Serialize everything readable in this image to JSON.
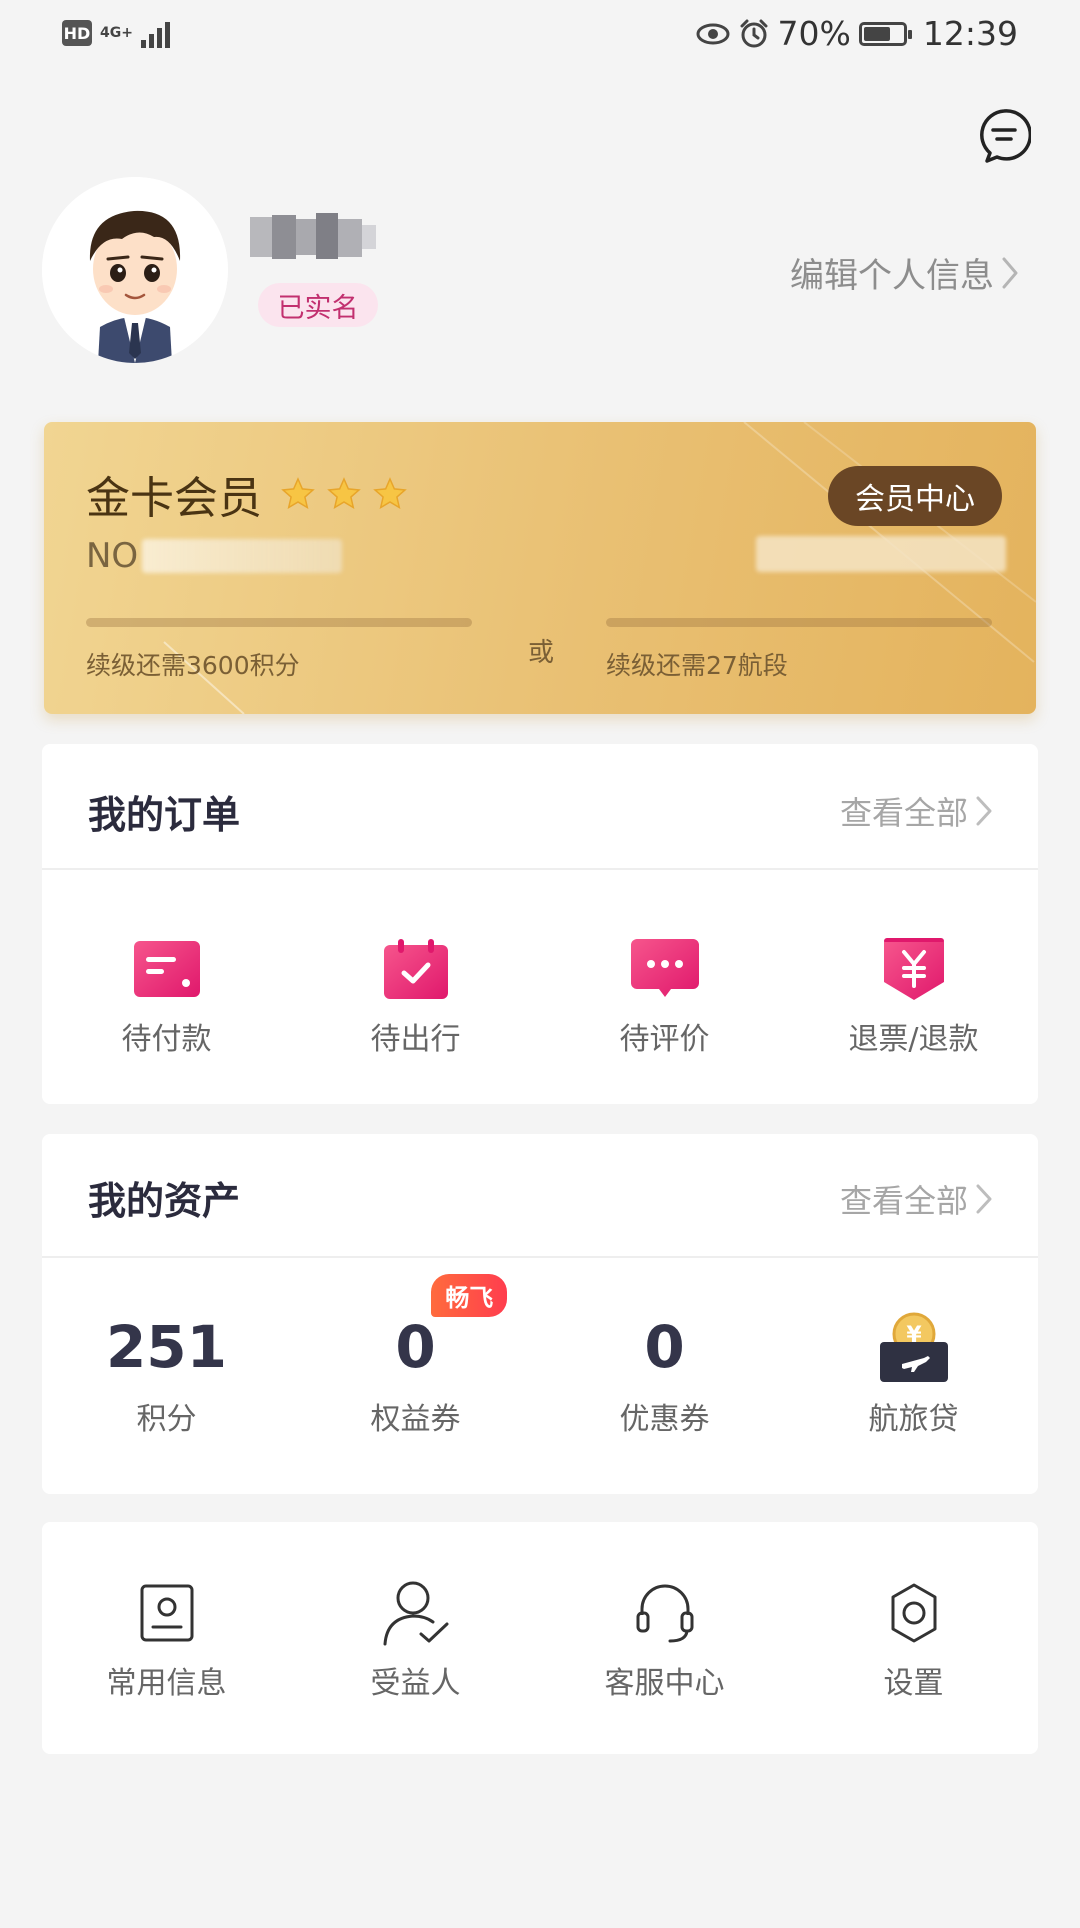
{
  "status_bar": {
    "hd_label": "HD",
    "network": "4G+",
    "battery_percent": "70%",
    "battery_level": 0.7,
    "time": "12:39",
    "icons": [
      "eye-icon",
      "alarm-icon"
    ]
  },
  "profile": {
    "verified_label": "已实名",
    "edit_label": "编辑个人信息"
  },
  "member_card": {
    "tier": "金卡会员",
    "star_count": 3,
    "card_no_prefix": "NO",
    "center_button": "会员中心",
    "points_requirement": "续级还需3600积分",
    "segments_requirement": "续级还需27航段",
    "or_label": "或",
    "points_progress": 0.0,
    "segments_progress": 0.0,
    "colors": {
      "accent": "#6a4625",
      "gradient_start": "#f1d592",
      "gradient_end": "#e4b35d"
    }
  },
  "orders": {
    "title": "我的订单",
    "view_all": "查看全部",
    "items": [
      {
        "label": "待付款",
        "icon": "payment-card-icon"
      },
      {
        "label": "待出行",
        "icon": "calendar-check-icon"
      },
      {
        "label": "待评价",
        "icon": "comment-icon"
      },
      {
        "label": "退票/退款",
        "icon": "refund-icon"
      }
    ],
    "icon_color": "#e8267a"
  },
  "assets": {
    "title": "我的资产",
    "view_all": "查看全部",
    "items": [
      {
        "value": "251",
        "label": "积分"
      },
      {
        "value": "0",
        "label": "权益券",
        "badge": "畅飞"
      },
      {
        "value": "0",
        "label": "优惠券"
      },
      {
        "label": "航旅贷",
        "icon": "travel-loan-icon"
      }
    ]
  },
  "tools": {
    "items": [
      {
        "label": "常用信息",
        "icon": "contact-card-icon"
      },
      {
        "label": "受益人",
        "icon": "beneficiary-icon"
      },
      {
        "label": "客服中心",
        "icon": "headset-icon"
      },
      {
        "label": "设置",
        "icon": "settings-gear-icon"
      }
    ]
  }
}
